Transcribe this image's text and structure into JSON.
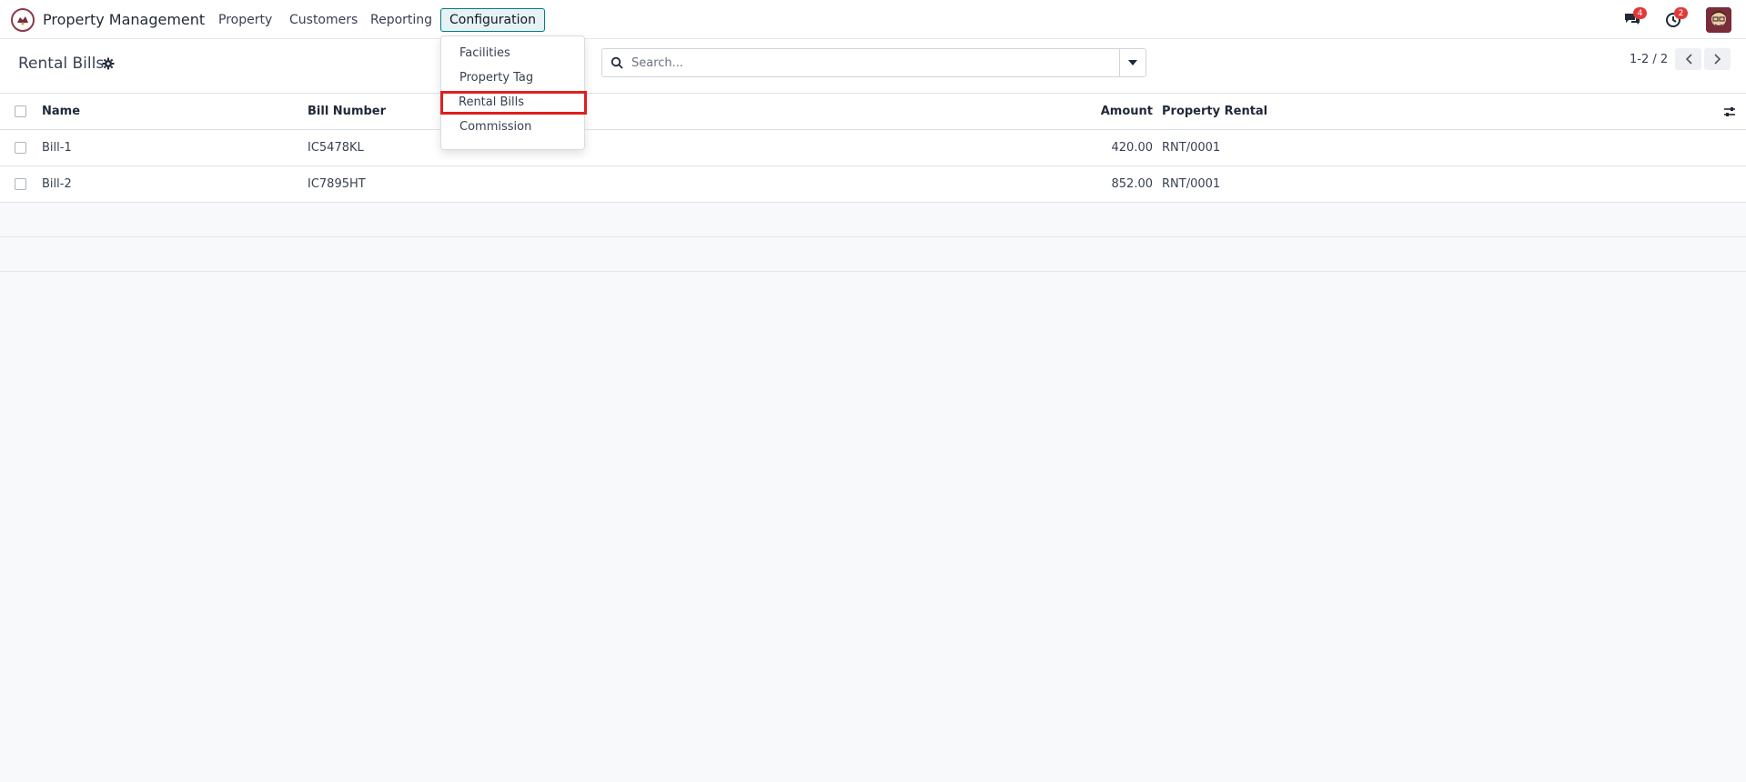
{
  "app": {
    "name": "Property Management",
    "menu": [
      "Property",
      "Customers",
      "Reporting",
      "Configuration"
    ],
    "messages_badge": "4",
    "activities_badge": "2"
  },
  "icons": {
    "logo": "app-logo-icon",
    "messages": "chat-icon",
    "activities": "clock-icon",
    "settings": "gear-icon",
    "search": "search-icon",
    "dropdown": "caret-down-icon",
    "prev": "chevron-left-icon",
    "next": "chevron-right-icon",
    "optional_columns": "sliders-icon"
  },
  "dropdown": {
    "items": [
      "Facilities",
      "Property Tag",
      "Rental Bills",
      "Commission"
    ]
  },
  "control_panel": {
    "title": "Rental Bills",
    "search_placeholder": "Search...",
    "pager": "1-2 / 2"
  },
  "table": {
    "headers": [
      "Name",
      "Bill Number",
      "Amount",
      "Property Rental"
    ],
    "rows": [
      [
        "Bill-1",
        "IC5478KL",
        "420.00",
        "RNT/0001"
      ],
      [
        "Bill-2",
        "IC7895HT",
        "852.00",
        "RNT/0001"
      ]
    ]
  },
  "colors": {
    "accent": "#017e84",
    "highlight": "#e11d1d",
    "badge": "#e03a3a"
  }
}
